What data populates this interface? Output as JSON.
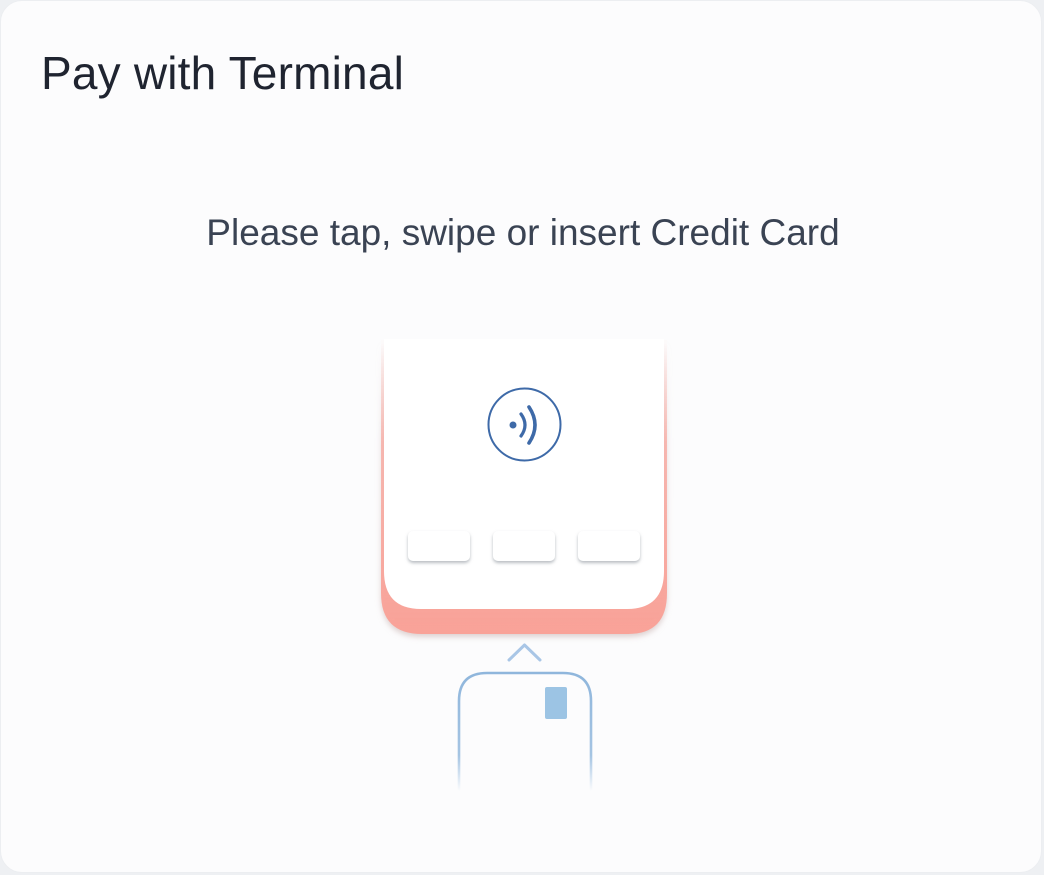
{
  "dialog": {
    "title": "Pay with Terminal",
    "prompt": "Please tap, swipe or insert Credit Card"
  },
  "illustration": {
    "terminal_icon": "contactless-icon",
    "card_icon": "credit-card-icon",
    "arrow_icon": "chevron-up-icon",
    "colors": {
      "terminal_edge": "#f9a298",
      "contactless": "#3e6aa8",
      "card_outline": "#8fb6dc",
      "card_chip": "#9cc4e4",
      "key": "#ffffff"
    }
  }
}
